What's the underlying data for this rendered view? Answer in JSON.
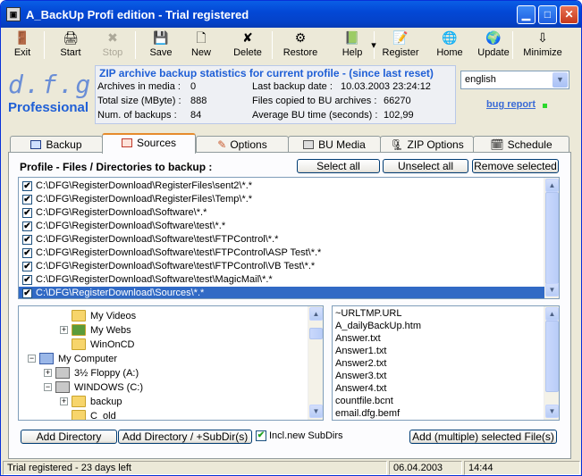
{
  "window": {
    "title": "A_BackUp Profi edition - Trial registered"
  },
  "toolbar": [
    {
      "name": "exit",
      "label": "Exit",
      "icon": "exit-icon",
      "glyph": "🚪"
    },
    {
      "name": "start",
      "label": "Start",
      "icon": "start-icon",
      "glyph": "🖨"
    },
    {
      "name": "stop",
      "label": "Stop",
      "icon": "stop-icon",
      "glyph": "✖"
    },
    {
      "name": "save",
      "label": "Save",
      "icon": "save-icon",
      "glyph": "💾"
    },
    {
      "name": "new",
      "label": "New",
      "icon": "new-icon",
      "glyph": "🗋"
    },
    {
      "name": "delete",
      "label": "Delete",
      "icon": "delete-icon",
      "glyph": "✘"
    },
    {
      "name": "restore",
      "label": "Restore",
      "icon": "restore-icon",
      "glyph": "⚙"
    },
    {
      "name": "help",
      "label": "Help",
      "icon": "help-icon",
      "glyph": "📗"
    },
    {
      "name": "register",
      "label": "Register",
      "icon": "register-icon",
      "glyph": "📝"
    },
    {
      "name": "home",
      "label": "Home",
      "icon": "home-icon",
      "glyph": "🌐"
    },
    {
      "name": "update",
      "label": "Update",
      "icon": "update-icon",
      "glyph": "🌍"
    },
    {
      "name": "minimize",
      "label": "Minimize",
      "icon": "minimize-icon",
      "glyph": "⇩"
    }
  ],
  "logo": {
    "text": "d.f.g",
    "edition": "Professional"
  },
  "stats": {
    "header": "ZIP archive backup statistics for current profile - (since last reset)",
    "archives_label": "Archives in media :",
    "archives_value": "0",
    "size_label": "Total size (MByte)  :",
    "size_value": "888",
    "num_label": "Num. of backups    :",
    "num_value": "84",
    "last_label": "Last backup date  :",
    "last_value": "10.03.2003 23:24:12",
    "copied_label": "Files copied to BU archives  :",
    "copied_value": "66270",
    "avg_label": "Average  BU time (seconds) :",
    "avg_value": "102,99"
  },
  "language": {
    "selected": "english"
  },
  "bug_report": "bug report",
  "tabs": [
    "Backup",
    "Sources",
    "Options",
    "BU Media",
    "ZIP Options",
    "Schedule"
  ],
  "active_tab": "Sources",
  "panel": {
    "title": "Profile - Files / Directories to backup :",
    "select_all": "Select all",
    "unselect_all": "Unselect all",
    "remove_selected": "Remove selected",
    "entries": [
      "C:\\DFG\\RegisterDownload\\RegisterFiles\\sent2\\*.*",
      "C:\\DFG\\RegisterDownload\\RegisterFiles\\Temp\\*.*",
      "C:\\DFG\\RegisterDownload\\Software\\*.*",
      "C:\\DFG\\RegisterDownload\\Software\\test\\*.*",
      "C:\\DFG\\RegisterDownload\\Software\\test\\FTPControl\\*.*",
      "C:\\DFG\\RegisterDownload\\Software\\test\\FTPControl\\ASP Test\\*.*",
      "C:\\DFG\\RegisterDownload\\Software\\test\\FTPControl\\VB Test\\*.*",
      "C:\\DFG\\RegisterDownload\\Software\\test\\MagicMail\\*.*",
      "C:\\DFG\\RegisterDownload\\Sources\\*.*"
    ],
    "tree": [
      {
        "label": "My Videos",
        "exp": ""
      },
      {
        "label": "My Webs",
        "exp": "+"
      },
      {
        "label": "WinOnCD",
        "exp": ""
      },
      {
        "label": "My Computer",
        "exp": "−"
      },
      {
        "label": "3½ Floppy (A:)",
        "exp": "+"
      },
      {
        "label": "WINDOWS (C:)",
        "exp": "−"
      },
      {
        "label": "backup",
        "exp": "+"
      },
      {
        "label": "C_old",
        "exp": ""
      }
    ],
    "files": [
      "~URLTMP.URL",
      "A_dailyBackUp.htm",
      "Answer.txt",
      "Answer1.txt",
      "Answer2.txt",
      "Answer3.txt",
      "Answer4.txt",
      "countfile.bcnt",
      "email.dfg.bemf"
    ],
    "add_directory": "Add  Directory",
    "add_directory_sub": "Add Directory / +SubDir(s)",
    "incl_new_subdirs": "Incl.new SubDirs",
    "add_files": "Add (multiple) selected  File(s)"
  },
  "statusbar": {
    "trial": "Trial registered - 23 days left",
    "date": "06.04.2003",
    "time": "14:44"
  }
}
